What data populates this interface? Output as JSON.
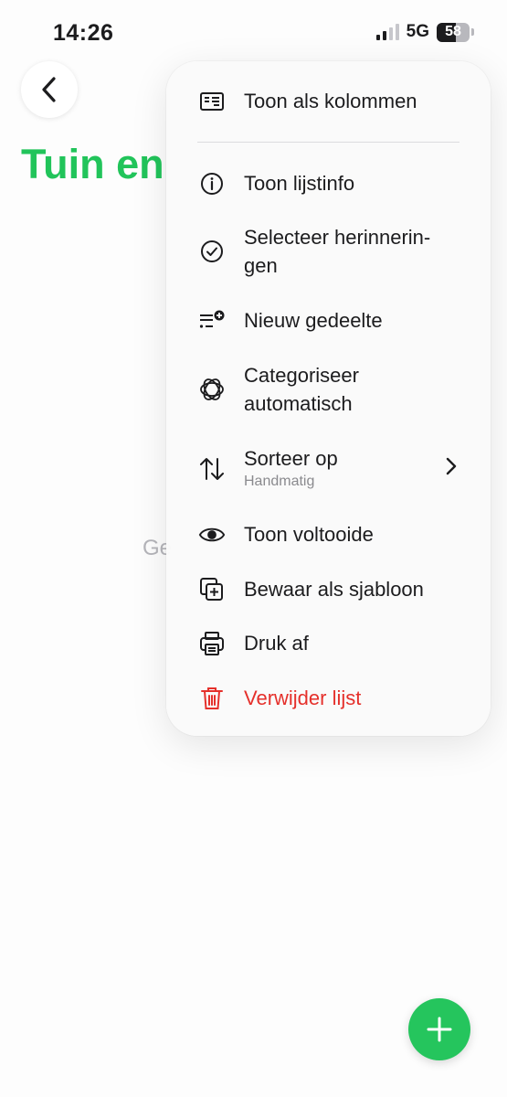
{
  "status": {
    "time": "14:26",
    "network": "5G",
    "battery": "58",
    "battery_level": 0.58
  },
  "page": {
    "title": "Tuin en",
    "empty_hint": "Ge"
  },
  "menu": {
    "items": [
      {
        "label": "Toon als kolommen",
        "icon": "columns-icon"
      },
      {
        "label": "Toon lijstinfo",
        "icon": "info-icon"
      },
      {
        "label": "Selecteer herinnerin-\ngen",
        "icon": "checkmark-circle-icon"
      },
      {
        "label": "Nieuw gedeelte",
        "icon": "new-section-icon"
      },
      {
        "label": "Categoriseer automatisch",
        "icon": "auto-categorize-icon"
      },
      {
        "label": "Sorteer op",
        "sublabel": "Handmatig",
        "icon": "sort-icon"
      },
      {
        "label": "Toon voltooide",
        "icon": "eye-icon"
      },
      {
        "label": "Bewaar als sjabloon",
        "icon": "template-icon"
      },
      {
        "label": "Druk af",
        "icon": "print-icon"
      },
      {
        "label": "Verwijder lijst",
        "icon": "trash-icon"
      }
    ]
  },
  "colors": {
    "accent_green": "#21c45a",
    "danger_red": "#e5302b"
  }
}
